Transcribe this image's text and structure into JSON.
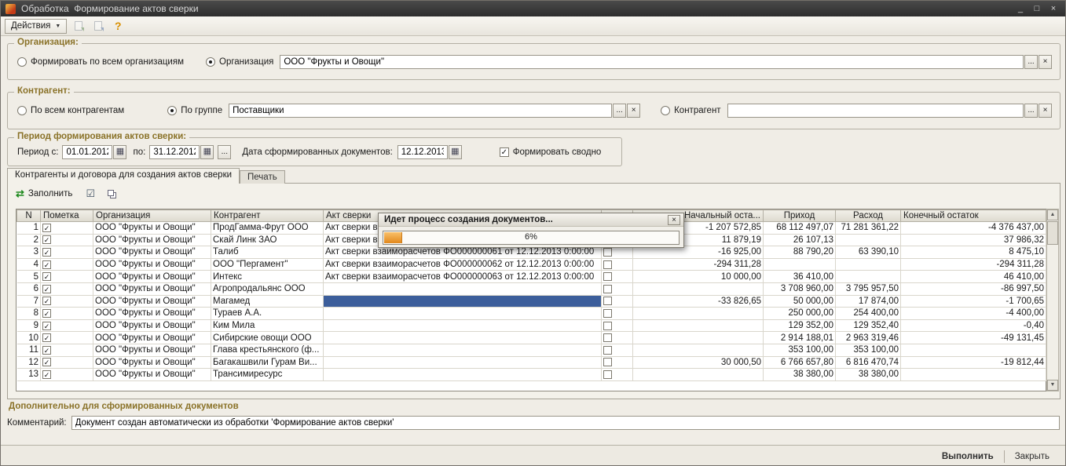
{
  "titlebar": {
    "title": "Обработка  Формирование актов сверки",
    "minimize": "_",
    "maximize": "□",
    "close": "×"
  },
  "toolbar": {
    "actions_label": "Действия",
    "help_icon": "?"
  },
  "org": {
    "legend": "Организация:",
    "radio_all": "Формировать по всем организациям",
    "radio_org": "Организация",
    "value": "ООО \"Фрукты и Овощи\""
  },
  "contragent": {
    "legend": "Контрагент:",
    "radio_all": "По всем контрагентам",
    "radio_group": "По группе",
    "group_value": "Поставщики",
    "radio_single": "Контрагент",
    "single_value": ""
  },
  "period": {
    "legend": "Период формирования актов сверки:",
    "from_label": "Период с:",
    "from_value": "01.01.2012",
    "to_label": "по:",
    "to_value": "31.12.2012",
    "doc_date_label": "Дата сформированных документов:",
    "doc_date_value": "12.12.2013",
    "consolidated_label": "Формировать сводно"
  },
  "tabs": {
    "contragents": "Контрагенты и договора для создания актов сверки",
    "print": "Печать"
  },
  "grid_toolbar": {
    "fill_label": "Заполнить"
  },
  "grid": {
    "columns": [
      "N",
      "Пометка",
      "Организация",
      "Контрагент",
      "Акт сверки",
      "",
      "Начальный оста...",
      "Приход",
      "Расход",
      "Конечный остаток"
    ],
    "rows": [
      {
        "n": "1",
        "marked": true,
        "flag": false,
        "org": "ООО \"Фрукты и Овощи\"",
        "contragent": "ПродГамма-Фрут ООО",
        "akt": "Акт сверки в",
        "nach": "-1 207 572,85",
        "prihod": "68 112 497,07",
        "rashod": "71 281 361,22",
        "konech": "-4 376 437,00"
      },
      {
        "n": "2",
        "marked": true,
        "flag": false,
        "org": "ООО \"Фрукты и Овощи\"",
        "contragent": "Скай Линк ЗАО",
        "akt": "Акт сверки в",
        "nach": "11 879,19",
        "prihod": "26 107,13",
        "konech": "37 986,32"
      },
      {
        "n": "3",
        "marked": true,
        "flag": false,
        "org": "ООО \"Фрукты и Овощи\"",
        "contragent": "Талиб",
        "akt": "Акт сверки взаиморасчетов ФО000000061 от 12.12.2013 0:00:00",
        "nach": "-16 925,00",
        "prihod": "88 790,20",
        "rashod": "63 390,10",
        "konech": "8 475,10"
      },
      {
        "n": "4",
        "marked": true,
        "flag": false,
        "org": "ООО \"Фрукты и Овощи\"",
        "contragent": "ООО \"Пергамент\"",
        "akt": "Акт сверки взаиморасчетов ФО000000062 от 12.12.2013 0:00:00",
        "nach": "-294 311,28",
        "konech": "-294 311,28"
      },
      {
        "n": "5",
        "marked": true,
        "flag": false,
        "org": "ООО \"Фрукты и Овощи\"",
        "contragent": "Интекс",
        "akt": "Акт сверки взаиморасчетов ФО000000063 от 12.12.2013 0:00:00",
        "nach": "10 000,00",
        "prihod": "36 410,00",
        "konech": "46 410,00"
      },
      {
        "n": "6",
        "marked": true,
        "flag": false,
        "org": "ООО \"Фрукты и Овощи\"",
        "contragent": "Агропродальянс ООО",
        "prihod": "3 708 960,00",
        "rashod": "3 795 957,50",
        "konech": "-86 997,50"
      },
      {
        "n": "7",
        "marked": true,
        "flag": false,
        "org": "ООО \"Фрукты и Овощи\"",
        "contragent": "Магамед",
        "akt": "",
        "akt_selected": true,
        "nach": "-33 826,65",
        "prihod": "50 000,00",
        "rashod": "17 874,00",
        "konech": "-1 700,65"
      },
      {
        "n": "8",
        "marked": true,
        "flag": false,
        "org": "ООО \"Фрукты и Овощи\"",
        "contragent": "Тураев А.А.",
        "prihod": "250 000,00",
        "rashod": "254 400,00",
        "konech": "-4 400,00"
      },
      {
        "n": "9",
        "marked": true,
        "flag": false,
        "org": "ООО \"Фрукты и Овощи\"",
        "contragent": "Ким Мила",
        "prihod": "129 352,00",
        "rashod": "129 352,40",
        "konech": "-0,40"
      },
      {
        "n": "10",
        "marked": true,
        "flag": false,
        "org": "ООО \"Фрукты и Овощи\"",
        "contragent": "Сибирские овощи ООО",
        "prihod": "2 914 188,01",
        "rashod": "2 963 319,46",
        "konech": "-49 131,45"
      },
      {
        "n": "11",
        "marked": true,
        "flag": false,
        "org": "ООО \"Фрукты и Овощи\"",
        "contragent": "Глава крестьянского (ф...",
        "prihod": "353 100,00",
        "rashod": "353 100,00"
      },
      {
        "n": "12",
        "marked": true,
        "flag": false,
        "org": "ООО \"Фрукты и Овощи\"",
        "contragent": "Багакашвили Гурам Ви...",
        "nach": "30 000,50",
        "prihod": "6 766 657,80",
        "rashod": "6 816 470,74",
        "konech": "-19 812,44"
      },
      {
        "n": "13",
        "marked": true,
        "flag": false,
        "org": "ООО \"Фрукты и Овощи\"",
        "contragent": "Трансимиресурс",
        "prihod": "38 380,00",
        "rashod": "38 380,00"
      }
    ]
  },
  "progress": {
    "title": "Идет процесс создания документов...",
    "percent": 6,
    "percent_label": "6%"
  },
  "additional": {
    "legend": "Дополнительно для сформированных документов",
    "comment_label": "Комментарий:",
    "comment_value": "Документ создан автоматически из обработки 'Формирование актов сверки'"
  },
  "footer": {
    "execute_label": "Выполнить",
    "close_label": "Закрыть"
  },
  "icons": {
    "calendar": "▦",
    "ellipsis": "...",
    "clear": "×",
    "dropdown": "▼",
    "check": "✓",
    "fill": "⇄",
    "flags": "☑",
    "scroll_up": "▲",
    "scroll_down": "▼"
  }
}
